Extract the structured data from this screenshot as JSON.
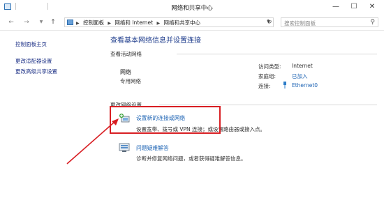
{
  "window": {
    "title": "网络和共享中心",
    "controls": {
      "minimize": "—",
      "maximize": "☐",
      "close": "✕"
    }
  },
  "address_bar": {
    "back": "←",
    "forward": "→",
    "up": "↑",
    "breadcrumbs": [
      "控制面板",
      "网络和 Internet",
      "网络和共享中心"
    ],
    "refresh": "↻",
    "search_placeholder": "搜索控制面板"
  },
  "sidebar": {
    "items": [
      {
        "label": "控制面板主页"
      },
      {
        "label": "更改适配器设置"
      },
      {
        "label": "更改高级共享设置"
      }
    ]
  },
  "main": {
    "heading": "查看基本网络信息并设置连接",
    "active_section": "查看活动网络",
    "network": {
      "name": "网络",
      "type": "专用网络",
      "access_type_label": "访问类型:",
      "access_type_value": "Internet",
      "homegroup_label": "家庭组:",
      "homegroup_value": "已加入",
      "connections_label": "连接:",
      "connections_value": "Ethernet0"
    },
    "change_section": "更改网络设置",
    "tasks": [
      {
        "link": "设置新的连接或网络",
        "description": "设置宽带、拨号或 VPN 连接；或设置路由器或接入点。"
      },
      {
        "link": "问题疑难解答",
        "description": "诊断并修复网络问题，或者获得疑难解答信息。"
      }
    ]
  },
  "colors": {
    "link": "#1e64b4",
    "nav_link": "#1e3287",
    "heading": "#1e3c8c",
    "highlight": "#d81e23"
  }
}
